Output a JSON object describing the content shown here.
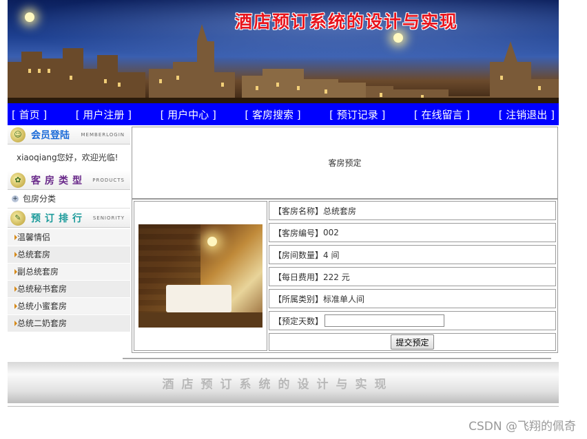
{
  "banner": {
    "title": "酒店预订系统的设计与实现"
  },
  "nav": {
    "items": [
      {
        "label": "[ 首页 ]"
      },
      {
        "label": "[ 用户注册 ]"
      },
      {
        "label": "[ 用户中心 ]"
      },
      {
        "label": "[ 客房搜索 ]"
      },
      {
        "label": "[ 预订记录 ]"
      },
      {
        "label": "[ 在线留言 ]"
      },
      {
        "label": "[ 注销退出 ]"
      }
    ]
  },
  "sidebar": {
    "member": {
      "title": "会员登陆",
      "en": "MEMBERLOGIN",
      "welcome": "xiaoqiang您好，欢迎光临!"
    },
    "rooms": {
      "title": "客房类型",
      "en": "PRODUCTS",
      "category": "包房分类"
    },
    "rank": {
      "title": "预订排行",
      "en": "SENIORITY",
      "items": [
        "温馨情侣",
        "总统套房",
        "副总统套房",
        "总统秘书套房",
        "总统小蜜套房",
        "总统二奶套房"
      ]
    }
  },
  "content": {
    "header": "客房预定",
    "fields": [
      {
        "label": "【客房名称】",
        "value": "总统套房"
      },
      {
        "label": "【客房编号】",
        "value": "002"
      },
      {
        "label": "【房间数量】",
        "value": "4 间"
      },
      {
        "label": "【每日费用】",
        "value": "222 元"
      },
      {
        "label": "【所属类别】",
        "value": "标准单人间"
      }
    ],
    "days_label": "【预定天数】",
    "days_value": "",
    "submit_label": "提交预定"
  },
  "footer": {
    "text": "酒店预订系统的设计与实现"
  },
  "watermark": "CSDN @飞翔的佩奇"
}
